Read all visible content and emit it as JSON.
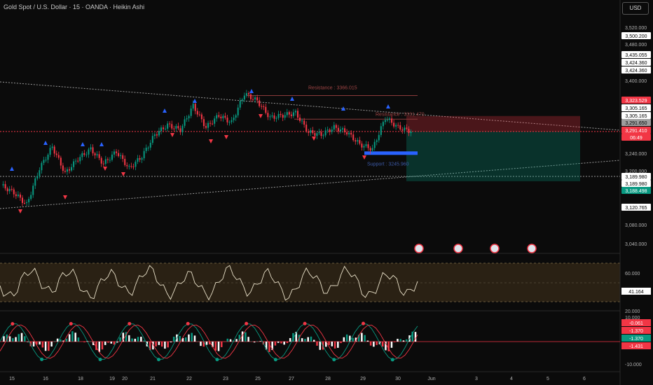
{
  "title": "Gold Spot / U.S. Dollar · 15 · OANDA · Heikin Ashi",
  "currency_button": "USD",
  "price_axis_ticks": [
    "3,520.000",
    "3,480.000",
    "3,400.000",
    "3,240.000",
    "3,200.000",
    "3,080.000",
    "3,040.000"
  ],
  "price_badges": [
    {
      "text": "3,500.200",
      "bg": "#ffffff",
      "fg": "#000000"
    },
    {
      "text": "3,435.055",
      "bg": "#ffffff",
      "fg": "#000000"
    },
    {
      "text": "3,424.360",
      "bg": "#ffffff",
      "fg": "#000000"
    },
    {
      "text": "3,424.360",
      "bg": "#ffffff",
      "fg": "#000000"
    },
    {
      "text": "3,323.529",
      "bg": "#f23645",
      "fg": "#ffffff"
    },
    {
      "text": "3,305.165",
      "bg": "#ffffff",
      "fg": "#000000"
    },
    {
      "text": "3,305.165",
      "bg": "#ffffff",
      "fg": "#000000"
    },
    {
      "text": "3,291.650",
      "bg": "#9e9e9e",
      "fg": "#000000"
    },
    {
      "text": "3,291.410",
      "bg": "#f23645",
      "fg": "#ffffff"
    },
    {
      "text": "06:49",
      "bg": "#f23645",
      "fg": "#ffffff"
    },
    {
      "text": "3,189.980",
      "bg": "#ffffff",
      "fg": "#000000"
    },
    {
      "text": "3,189.980",
      "bg": "#ffffff",
      "fg": "#000000"
    },
    {
      "text": "3,188.498",
      "bg": "#089981",
      "fg": "#ffffff"
    },
    {
      "text": "3,120.765",
      "bg": "#ffffff",
      "fg": "#000000"
    }
  ],
  "annotations": {
    "resistance1": "Resistance : 3366.015",
    "resistance2": "Resistance : 3331.470",
    "support": "Support : 3245.960"
  },
  "rsi": {
    "ticks": [
      "60.000",
      "20.000"
    ],
    "value": "41.164"
  },
  "macd": {
    "ticks": [
      "10.000",
      "-10.000"
    ],
    "badges": [
      {
        "text": "-0.061",
        "bg": "#f23645"
      },
      {
        "text": "-1.370",
        "bg": "#f23645"
      },
      {
        "text": "-1.370",
        "bg": "#089981"
      },
      {
        "text": "-1.431",
        "bg": "#f23645"
      }
    ]
  },
  "time_axis": [
    "15",
    "16",
    "18",
    "19",
    "20",
    "21",
    "22",
    "23",
    "25",
    "27",
    "28",
    "29",
    "30",
    "Jun",
    "3",
    "4",
    "5",
    "6"
  ],
  "colors": {
    "up": "#089981",
    "down": "#f23645",
    "rsi_line": "#e8e0c8"
  },
  "chart_data": {
    "type": "candlestick",
    "instrument": "Gold Spot / U.S. Dollar",
    "interval": "15",
    "ylim": [
      3040,
      3540
    ],
    "last_price": 3291.41,
    "levels": {
      "resistance": [
        3366.015,
        3331.47
      ],
      "support": 3245.96,
      "stop": 3323.529,
      "target": 3188.498
    },
    "x": [
      "15",
      "16",
      "18",
      "19",
      "20",
      "21",
      "22",
      "23",
      "25",
      "27",
      "28",
      "29",
      "30"
    ],
    "close_path": [
      3180,
      3165,
      3140,
      3215,
      3260,
      3205,
      3235,
      3255,
      3225,
      3250,
      3215,
      3240,
      3285,
      3305,
      3295,
      3345,
      3300,
      3325,
      3310,
      3370,
      3355,
      3320,
      3325,
      3330,
      3290,
      3285,
      3300,
      3290,
      3265,
      3255,
      3320,
      3300,
      3291.41
    ]
  }
}
